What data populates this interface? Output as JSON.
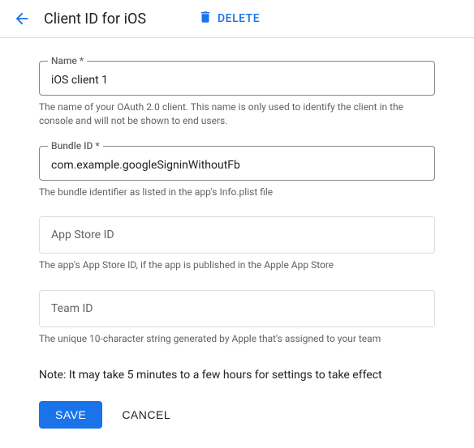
{
  "header": {
    "title": "Client ID for iOS",
    "delete_label": "DELETE"
  },
  "fields": {
    "name": {
      "label": "Name *",
      "value": "iOS client 1",
      "helper": "The name of your OAuth 2.0 client. This name is only used to identify the client in the console and will not be shown to end users."
    },
    "bundle": {
      "label": "Bundle ID *",
      "value": "com.example.googleSigninWithoutFb",
      "helper": "The bundle identifier as listed in the app's Info.plist file"
    },
    "appstore": {
      "placeholder": "App Store ID",
      "helper": "The app's App Store ID, if the app is published in the Apple App Store"
    },
    "team": {
      "placeholder": "Team ID",
      "helper": "The unique 10-character string generated by Apple that's assigned to your team"
    }
  },
  "note": "Note: It may take 5 minutes to a few hours for settings to take effect",
  "buttons": {
    "save": "SAVE",
    "cancel": "CANCEL"
  }
}
